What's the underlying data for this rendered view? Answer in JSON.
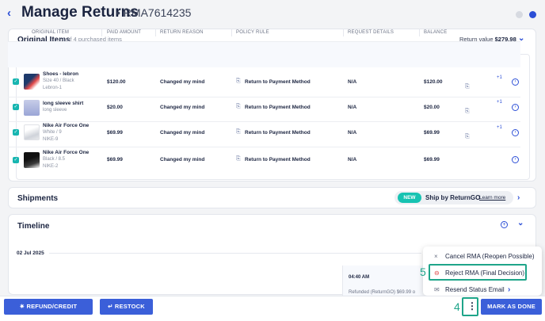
{
  "header": {
    "title": "Manage Returns",
    "rma_number": "• RMA7614235",
    "back_icon": "‹",
    "notification_count": ""
  },
  "original_items": {
    "title": "Original Items",
    "subtitle": "4 of 4 purchased items",
    "return_value_label": "Return value",
    "return_value": "$279.98",
    "columns": [
      "ORIGINAL ITEM",
      "PAID AMOUNT",
      "RETURN REASON",
      "POLICY RULE",
      "REQUEST DETAILS",
      "BALANCE"
    ],
    "rows": [
      {
        "name": "Shoes - lebron",
        "variant": "Size 40 / Black",
        "sku": "Lebron-1",
        "paid": "$120.00",
        "reason": "Changed my mind",
        "policy": "Return to Payment Method",
        "details": "N/A",
        "balance": "$120.00",
        "extra": "+1"
      },
      {
        "name": "long sleeve shirt",
        "variant": "long sleeve",
        "sku": "",
        "paid": "$20.00",
        "reason": "Changed my mind",
        "policy": "Return to Payment Method",
        "details": "N/A",
        "balance": "$20.00",
        "extra": "+1"
      },
      {
        "name": "Nike Air Force One",
        "variant": "White / 9",
        "sku": "NIKE-9",
        "paid": "$69.99",
        "reason": "Changed my mind",
        "policy": "Return to Payment Method",
        "details": "N/A",
        "balance": "$69.99",
        "extra": "+1"
      },
      {
        "name": "Nike Air Force One",
        "variant": "Black / 8.5",
        "sku": "NIKE-2",
        "paid": "$69.99",
        "reason": "Changed my mind",
        "policy": "Return to Payment Method",
        "details": "N/A",
        "balance": "$69.99",
        "extra": ""
      }
    ]
  },
  "shipments": {
    "title": "Shipments",
    "badge": "NEW",
    "promo": "Ship by ReturnGO",
    "link": "Learn more"
  },
  "timeline": {
    "title": "Timeline",
    "date": "02 Jul 2025",
    "time": "04:40 AM",
    "event": "Refunded (ReturnGO) $69.99 o"
  },
  "menu": {
    "items": [
      {
        "label": "Cancel RMA (Reopen Possible)",
        "icon": "×"
      },
      {
        "label": "Reject RMA (Final Decision)",
        "icon": "⊖"
      },
      {
        "label": "Resend Status Email",
        "icon": "✉"
      }
    ]
  },
  "annotations": {
    "step4": "4",
    "step5": "5"
  },
  "footer": {
    "refund": "REFUND/CREDIT",
    "restock": "RESTOCK",
    "more": "⋮",
    "done": "MARK AS DONE"
  },
  "colors": {
    "accent": "#3b5fd9",
    "teal": "#17b5b0",
    "annotation": "#1fa58a"
  }
}
